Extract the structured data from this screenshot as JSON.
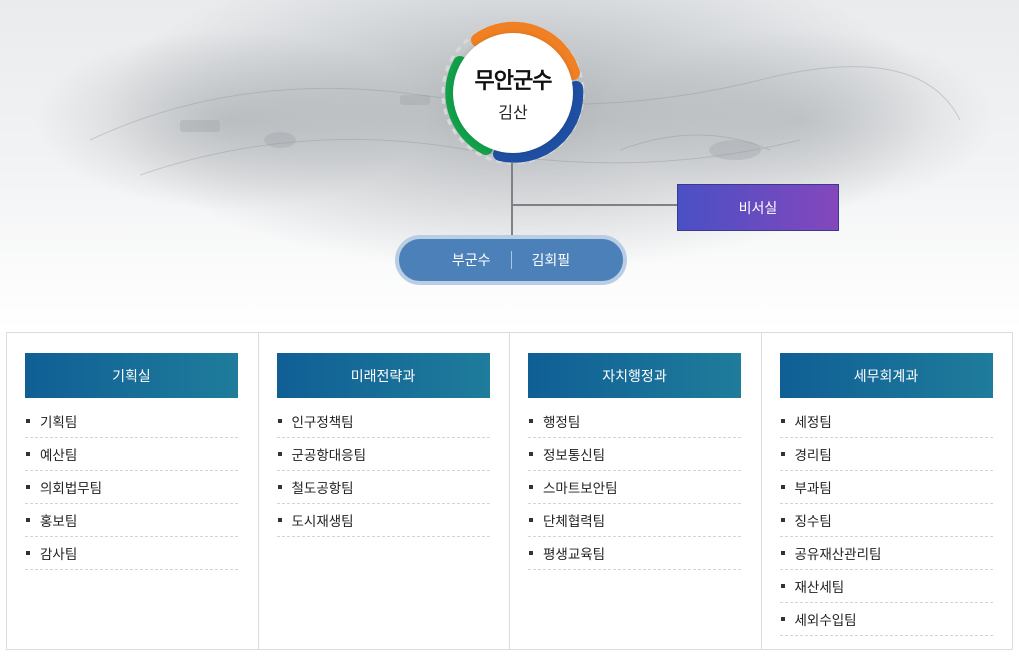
{
  "mayor": {
    "title": "무안군수",
    "name": "김산"
  },
  "secretary": {
    "label": "비서실"
  },
  "vice_mayor": {
    "title": "부군수",
    "name": "김회필"
  },
  "colors": {
    "ring_orange": "#f08023",
    "ring_blue": "#1f4fa3",
    "ring_green": "#12a04a",
    "secretary_from": "#4a50c5",
    "secretary_to": "#8447bc",
    "vice_fill": "#4b80b9",
    "dept_header": "#0f5f95"
  },
  "departments": [
    {
      "title": "기획실",
      "teams": [
        "기획팀",
        "예산팀",
        "의회법무팀",
        "홍보팀",
        "감사팀"
      ]
    },
    {
      "title": "미래전략과",
      "teams": [
        "인구정책팀",
        "군공항대응팀",
        "철도공항팀",
        "도시재생팀"
      ]
    },
    {
      "title": "자치행정과",
      "teams": [
        "행정팀",
        "정보통신팀",
        "스마트보안팀",
        "단체협력팀",
        "평생교육팀"
      ]
    },
    {
      "title": "세무회계과",
      "teams": [
        "세정팀",
        "경리팀",
        "부과팀",
        "징수팀",
        "공유재산관리팀",
        "재산세팀",
        "세외수입팀"
      ]
    }
  ]
}
